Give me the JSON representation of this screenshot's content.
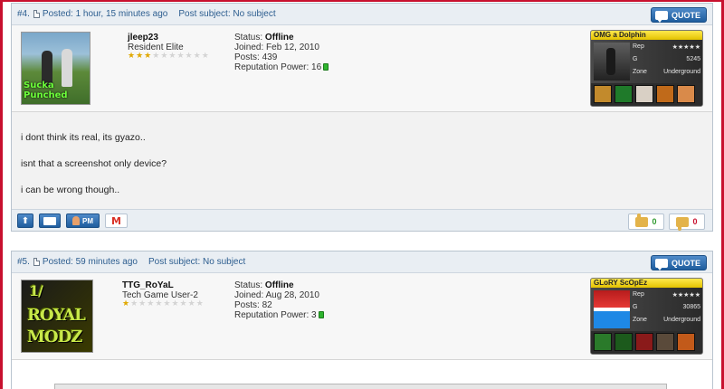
{
  "posts": [
    {
      "number": "#4.",
      "posted": "Posted: 1 hour, 15 minutes ago",
      "subject": "Post subject: No subject",
      "quote_label": "QUOTE",
      "user": {
        "name": "jleep23",
        "title": "Resident Elite",
        "stars_on": 3,
        "stars_total": 10,
        "avatar_caption": "Sucka Punched",
        "status_label": "Status:",
        "status_value": "Offline",
        "joined": "Joined: Feb 12, 2010",
        "posts": "Posts: 439",
        "reputation": "Reputation Power: 16"
      },
      "sig": {
        "title": "OMG a Dolphin",
        "rep_label": "Rep",
        "rep_value": "★★★★★",
        "g_label": "G",
        "g_value": "5245",
        "zone_label": "Zone",
        "zone_value": "Underground"
      },
      "body": [
        "i dont think its real, its gyazo..",
        "isnt that a screenshot only device?",
        "i can be wrong though.."
      ],
      "footer": {
        "pm_label": "PM",
        "likes": "0",
        "dislikes": "0"
      }
    },
    {
      "number": "#5.",
      "posted": "Posted: 59 minutes ago",
      "subject": "Post subject: No subject",
      "quote_label": "QUOTE",
      "user": {
        "name": "TTG_RoYaL",
        "title": "Tech Game User-2",
        "stars_on": 1,
        "stars_total": 10,
        "avatar_words": [
          "1/",
          "ROYAL",
          "MODZ"
        ],
        "status_label": "Status:",
        "status_value": "Offline",
        "joined": "Joined: Aug 28, 2010",
        "posts": "Posts: 82",
        "reputation": "Reputation Power: 3"
      },
      "sig": {
        "title": "GLoRY ScOpEz",
        "rep_label": "Rep",
        "rep_value": "★★★★★",
        "g_label": "G",
        "g_value": "30865",
        "zone_label": "Zone",
        "zone_value": "Underground"
      }
    }
  ],
  "colors": {
    "frame": "#c8102e",
    "header_bg": "#e9eef3",
    "link": "#2c5d8f",
    "button": "#1f5d9e"
  }
}
